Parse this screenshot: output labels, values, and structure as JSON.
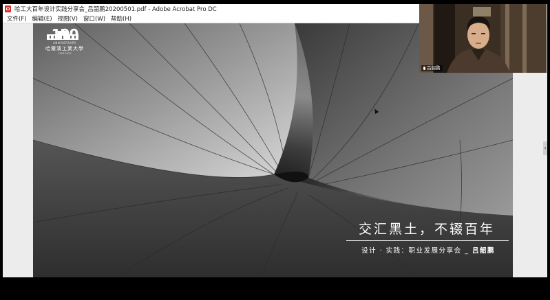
{
  "window": {
    "title": "哈工大百年设计实践分享会_吕韶鹏20200501.pdf - Adobe Acrobat Pro DC"
  },
  "menu": [
    "文件(F)",
    "编辑(E)",
    "视图(V)",
    "窗口(W)",
    "帮助(H)"
  ],
  "logo": {
    "anniversary": "100",
    "anniversary_sub": "ANNIVERSARY",
    "university_name": "哈爾濱工業大學",
    "university_sub": "1920-2020"
  },
  "slide": {
    "title": "交汇黑土，不辍百年",
    "subtitle_prefix": "设计 · 实践：职业发展分享会 _ ",
    "subtitle_name": "吕韶鹏"
  },
  "webcam": {
    "participant_name": "吕韶鹏"
  },
  "side_handle": "‹"
}
